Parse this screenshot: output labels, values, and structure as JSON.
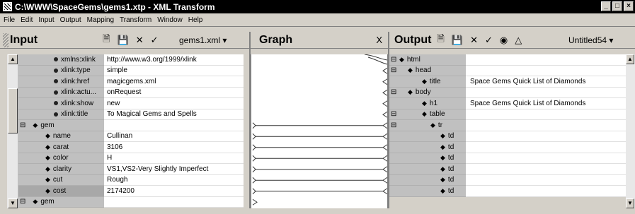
{
  "window": {
    "title": "C:\\WWW\\SpaceGems\\gems1.xtp - XML Transform"
  },
  "menu": [
    "File",
    "Edit",
    "Input",
    "Output",
    "Mapping",
    "Transform",
    "Window",
    "Help"
  ],
  "input": {
    "title": "Input",
    "file": "gems1.xml ▾",
    "rows": [
      {
        "label": "xmlns:xlink",
        "value": "http://www.w3.org/1999/xlink",
        "indent": 50,
        "kind": "attr"
      },
      {
        "label": "xlink:type",
        "value": "simple",
        "indent": 50,
        "kind": "attr"
      },
      {
        "label": "xlink:href",
        "value": "magicgems.xml",
        "indent": 50,
        "kind": "attr"
      },
      {
        "label": "xlink:actu...",
        "value": "onRequest",
        "indent": 50,
        "kind": "attr"
      },
      {
        "label": "xlink:show",
        "value": "new",
        "indent": 50,
        "kind": "attr"
      },
      {
        "label": "xlink:title",
        "value": "To Magical Gems and Spells",
        "indent": 50,
        "kind": "attr"
      },
      {
        "label": "gem",
        "value": "",
        "indent": 2,
        "kind": "elem-exp"
      },
      {
        "label": "name",
        "value": "Cullinan",
        "indent": 38,
        "kind": "elem"
      },
      {
        "label": "carat",
        "value": "3106",
        "indent": 38,
        "kind": "elem"
      },
      {
        "label": "color",
        "value": "H",
        "indent": 38,
        "kind": "elem"
      },
      {
        "label": "clarity",
        "value": "VS1,VS2-Very Slightly Imperfect",
        "indent": 38,
        "kind": "elem"
      },
      {
        "label": "cut",
        "value": "Rough",
        "indent": 38,
        "kind": "elem"
      },
      {
        "label": "cost",
        "value": "2174200",
        "indent": 38,
        "kind": "elem-sel"
      },
      {
        "label": "gem",
        "value": "",
        "indent": 2,
        "kind": "elem-exp"
      }
    ]
  },
  "graph": {
    "title": "Graph",
    "close": "X"
  },
  "output": {
    "title": "Output",
    "file": "Untitled54 ▾",
    "rows": [
      {
        "label": "html",
        "value": "",
        "indent": 2,
        "exp": true
      },
      {
        "label": "head",
        "value": "",
        "indent": 14,
        "exp": true
      },
      {
        "label": "title",
        "value": "Space Gems Quick List of Diamonds",
        "indent": 34,
        "exp": false
      },
      {
        "label": "body",
        "value": "",
        "indent": 14,
        "exp": true
      },
      {
        "label": "h1",
        "value": "Space Gems Quick List of Diamonds",
        "indent": 34,
        "exp": false
      },
      {
        "label": "table",
        "value": "",
        "indent": 34,
        "exp": true
      },
      {
        "label": "tr",
        "value": "",
        "indent": 46,
        "exp": true
      },
      {
        "label": "td",
        "value": "",
        "indent": 60,
        "exp": false
      },
      {
        "label": "td",
        "value": "",
        "indent": 60,
        "exp": false
      },
      {
        "label": "td",
        "value": "",
        "indent": 60,
        "exp": false
      },
      {
        "label": "td",
        "value": "",
        "indent": 60,
        "exp": false
      },
      {
        "label": "td",
        "value": "",
        "indent": 60,
        "exp": false
      },
      {
        "label": "td",
        "value": "",
        "indent": 60,
        "exp": false
      }
    ]
  }
}
